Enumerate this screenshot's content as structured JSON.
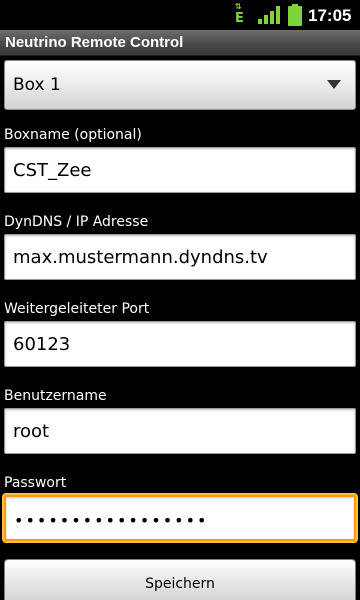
{
  "status_bar": {
    "network_type": "E",
    "network_arrows": "⇅",
    "time": "17:05",
    "icons": [
      "network-edge-icon",
      "signal-icon",
      "battery-icon"
    ],
    "icon_color": "#7fd43a"
  },
  "app": {
    "title": "Neutrino Remote Control"
  },
  "box_spinner": {
    "selected": "Box 1",
    "icon": "chevron-down-icon"
  },
  "form": {
    "boxname": {
      "label": "Boxname (optional)",
      "value": "CST_Zee"
    },
    "host": {
      "label": "DynDNS / IP Adresse",
      "value": "max.mustermann.dyndns.tv"
    },
    "port": {
      "label": "Weitergeleiteter Port",
      "value": "60123"
    },
    "username": {
      "label": "Benutzername",
      "value": "root"
    },
    "password": {
      "label": "Passwort",
      "masked_value": "•••••••••••••••••"
    },
    "focus_color": "#ff9a00"
  },
  "actions": {
    "save_label": "Speichern"
  }
}
